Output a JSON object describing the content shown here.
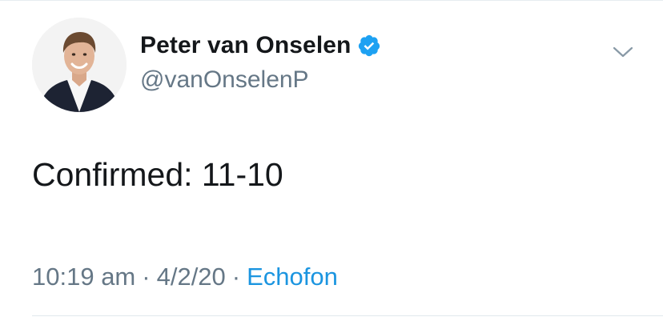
{
  "tweet": {
    "author": {
      "display_name": "Peter van Onselen",
      "handle": "@vanOnselenP",
      "verified": true,
      "avatar_icon": "profile-photo"
    },
    "text": "Confirmed: 11-10",
    "meta": {
      "time": "10:19 am",
      "separator": "·",
      "date": "4/2/20",
      "source": "Echofon"
    },
    "menu_icon": "chevron-down-icon"
  },
  "colors": {
    "text_primary": "#14171a",
    "text_secondary": "#657786",
    "link": "#1b95e0",
    "verified": "#1da1f2",
    "divider": "#e1e8ed"
  }
}
